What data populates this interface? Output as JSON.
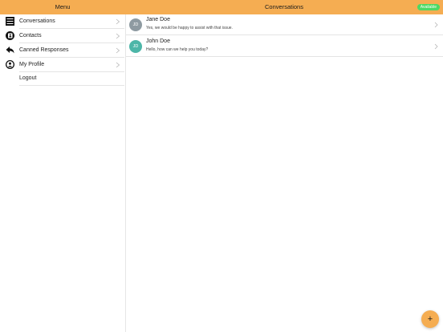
{
  "header": {
    "menu_title": "Menu",
    "conversations_title": "Conversations",
    "status_label": "Available"
  },
  "sidebar": {
    "items": [
      {
        "label": "Conversations",
        "icon": "list-icon"
      },
      {
        "label": "Contacts",
        "icon": "contacts-book-icon"
      },
      {
        "label": "Canned Responses",
        "icon": "reply-icon"
      },
      {
        "label": "My Profile",
        "icon": "profile-icon"
      },
      {
        "label": "Logout",
        "icon": ""
      }
    ]
  },
  "conversations": [
    {
      "initials": "JD",
      "name": "Jane Doe",
      "preview": "Yes, we would be happy to assist with that issue.",
      "avatar_color": "#8e9aa1"
    },
    {
      "initials": "JD",
      "name": "John Doe",
      "preview": "Hello, how can we help you today?",
      "avatar_color": "#4db6a8"
    }
  ],
  "fab": {
    "label": "+",
    "icon": "plus-icon"
  },
  "colors": {
    "header_bg": "#f5ad52",
    "status_badge": "#4cd964",
    "divider": "#e4e4e4"
  }
}
